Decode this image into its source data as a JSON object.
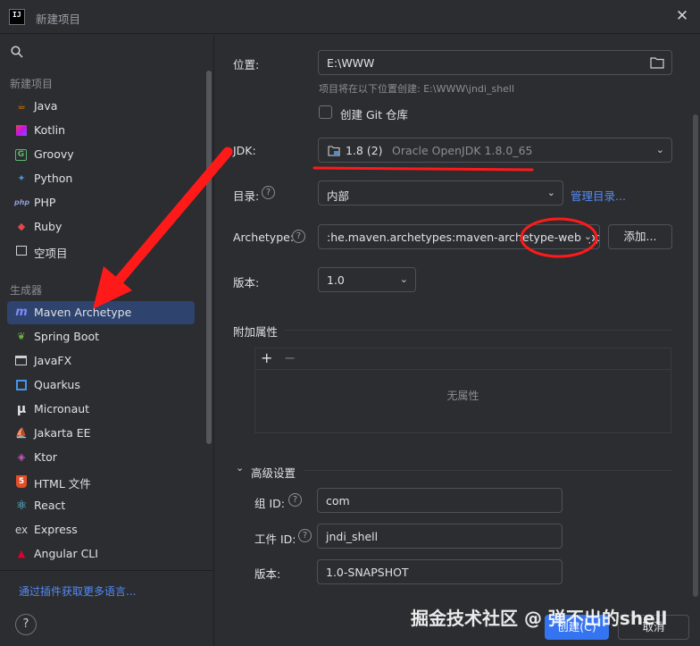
{
  "window": {
    "title": "新建项目",
    "app_icon_text": "IJ"
  },
  "sidebar": {
    "group1": "新建项目",
    "items1": [
      {
        "label": "Java",
        "icon": "java-icon"
      },
      {
        "label": "Kotlin",
        "icon": "kotlin-icon"
      },
      {
        "label": "Groovy",
        "icon": "groovy-icon"
      },
      {
        "label": "Python",
        "icon": "python-icon"
      },
      {
        "label": "PHP",
        "icon": "php-icon"
      },
      {
        "label": "Ruby",
        "icon": "ruby-icon"
      },
      {
        "label": "空项目",
        "icon": "empty-project-icon"
      }
    ],
    "group2": "生成器",
    "items2": [
      {
        "label": "Maven Archetype",
        "icon": "maven-icon",
        "selected": true
      },
      {
        "label": "Spring Boot",
        "icon": "spring-icon"
      },
      {
        "label": "JavaFX",
        "icon": "javafx-icon"
      },
      {
        "label": "Quarkus",
        "icon": "quarkus-icon"
      },
      {
        "label": "Micronaut",
        "icon": "micronaut-icon"
      },
      {
        "label": "Jakarta EE",
        "icon": "jakarta-icon"
      },
      {
        "label": "Ktor",
        "icon": "ktor-icon"
      },
      {
        "label": "HTML 文件",
        "icon": "html-icon"
      },
      {
        "label": "React",
        "icon": "react-icon"
      },
      {
        "label": "Express",
        "icon": "express-icon"
      },
      {
        "label": "Angular CLI",
        "icon": "angular-icon"
      }
    ],
    "plugin_link": "通过插件获取更多语言...",
    "help": "?"
  },
  "form": {
    "location_label": "位置:",
    "location_value": "E:\\WWW",
    "location_hint": "项目将在以下位置创建: E:\\WWW\\jndi_shell",
    "git_label": "创建 Git 仓库",
    "jdk_label": "JDK:",
    "jdk_version": "1.8 (2)",
    "jdk_name": "Oracle OpenJDK 1.8.0_65",
    "catalog_label": "目录:",
    "catalog_value": "内部",
    "manage_catalog": "管理目录...",
    "archetype_label": "Archetype:",
    "archetype_value": ":he.maven.archetypes:maven-archetype-webapp",
    "add_button": "添加...",
    "version_label": "版本:",
    "version_value": "1.0",
    "props_title": "附加属性",
    "props_add": "+",
    "props_remove": "−",
    "props_empty": "无属性",
    "advanced_title": "高级设置",
    "group_id_label": "组 ID:",
    "group_id_value": "com",
    "artifact_id_label": "工件 ID:",
    "artifact_id_value": "jndi_shell",
    "adv_version_label": "版本:",
    "adv_version_value": "1.0-SNAPSHOT"
  },
  "footer": {
    "create": "创建(C)",
    "cancel": "取消"
  },
  "watermark": "掘金技术社区 @ 弹不出的shell",
  "colors": {
    "accent": "#3574f0",
    "annotation": "#ff1a1a",
    "selection": "#2e436e"
  }
}
